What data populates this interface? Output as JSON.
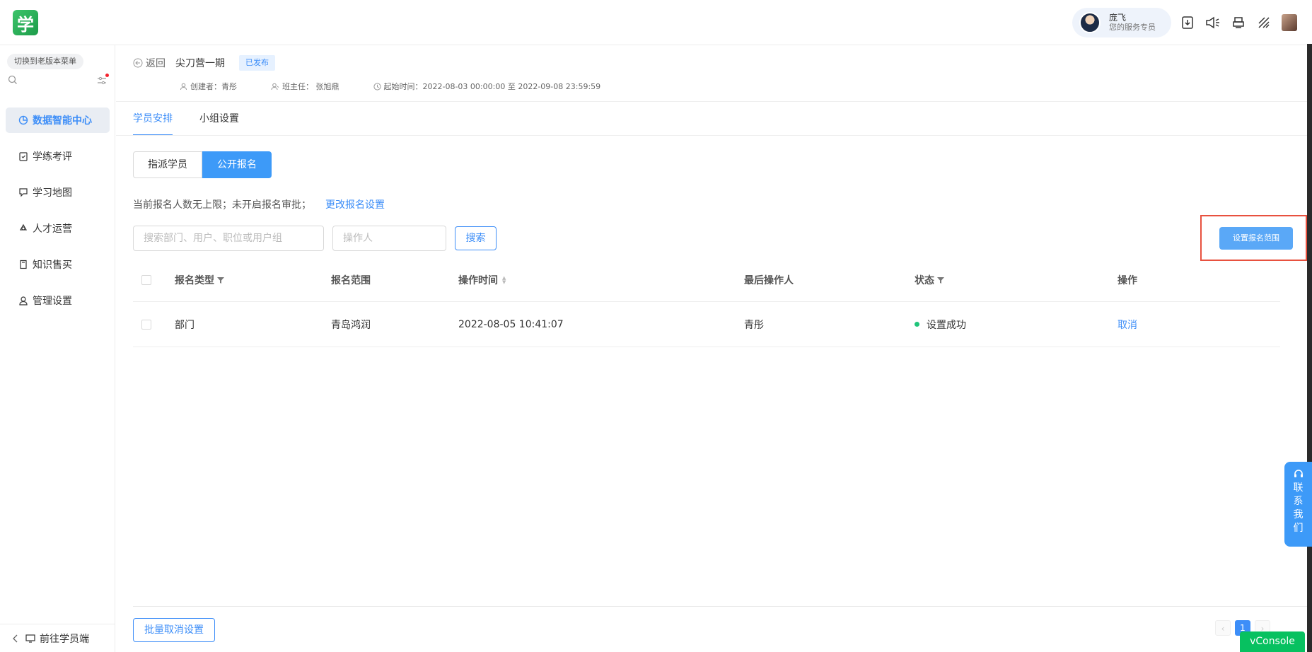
{
  "topbar": {
    "logo_text": "学",
    "service": {
      "name": "庞飞",
      "role": "您的服务专员"
    },
    "icons": [
      "download-icon",
      "volume-icon",
      "printer-icon",
      "stripes-icon"
    ]
  },
  "sidebar": {
    "switch_label": "切换到老版本菜单",
    "items": [
      {
        "label": "数据智能中心",
        "icon": "pie-chart-icon",
        "active": true
      },
      {
        "label": "学练考评",
        "icon": "clipboard-check-icon",
        "active": false
      },
      {
        "label": "学习地图",
        "icon": "map-flag-icon",
        "active": false
      },
      {
        "label": "人才运营",
        "icon": "recycle-icon",
        "active": false
      },
      {
        "label": "知识售买",
        "icon": "book-icon",
        "active": false
      },
      {
        "label": "管理设置",
        "icon": "user-icon",
        "active": false
      }
    ],
    "bottom_label": "前往学员端"
  },
  "header": {
    "back_label": "返回",
    "title": "尖刀营一期",
    "status_badge": "已发布",
    "creator": "创建者：青彤",
    "teacher": "班主任：  张旭鼎",
    "time": "起始时间：2022-08-03 00:00:00 至 2022-09-08 23:59:59"
  },
  "tabs": [
    "学员安排",
    "小组设置"
  ],
  "segment": [
    "指派学员",
    "公开报名"
  ],
  "info": {
    "text": "当前报名人数无上限；未开启报名审批；",
    "link": "更改报名设置"
  },
  "filters": {
    "search_placeholder": "搜索部门、用户、职位或用户组",
    "operator_placeholder": "操作人",
    "search_button": "搜索",
    "range_button": "设置报名范围"
  },
  "table": {
    "headers": [
      "报名类型",
      "报名范围",
      "操作时间",
      "最后操作人",
      "状态",
      "操作"
    ],
    "rows": [
      {
        "type": "部门",
        "range": "青岛鸿润",
        "time": "2022-08-05 10:41:07",
        "operator": "青彤",
        "status": "设置成功",
        "action": "取消"
      }
    ]
  },
  "footer": {
    "batch_button": "批量取消设置",
    "page": "1"
  },
  "contact": {
    "label": "联系我们"
  },
  "vconsole": "vConsole",
  "colors": {
    "accent": "#3d8ef8",
    "success": "#1fc47a",
    "highlight_border": "#e8513f",
    "vconsole": "#07c160"
  }
}
